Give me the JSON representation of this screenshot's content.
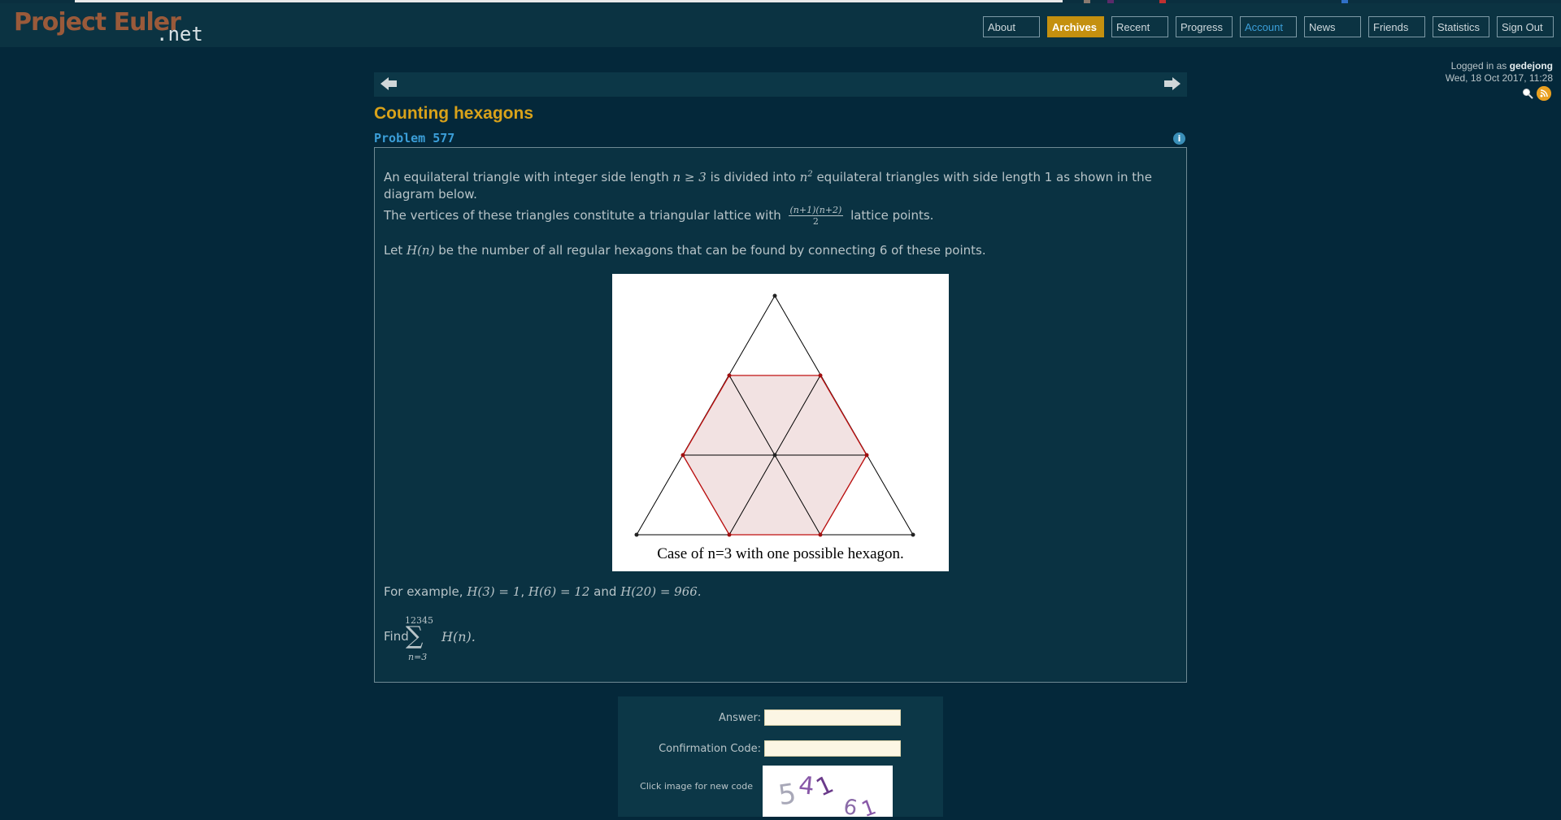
{
  "header": {
    "logo": "Project Euler",
    "logo_suffix": ".net",
    "nav": [
      {
        "label": "About"
      },
      {
        "label": "Archives"
      },
      {
        "label": "Recent"
      },
      {
        "label": "Progress"
      },
      {
        "label": "Account"
      },
      {
        "label": "News"
      },
      {
        "label": "Friends"
      },
      {
        "label": "Statistics"
      },
      {
        "label": "Sign Out"
      }
    ],
    "active_tab": "Archives"
  },
  "user": {
    "prefix": "Logged in as",
    "name": "gedejong",
    "datetime": "Wed, 18 Oct 2017, 11:28"
  },
  "problem": {
    "title": "Counting hexagons",
    "number": "Problem 577",
    "p1a": "An equilateral triangle with integer side length",
    "p1m1": "n ≥ 3",
    "p1b": "is divided into",
    "p1m2": "n",
    "p1m2exp": "2",
    "p1c": "equilateral triangles with side length 1 as shown in the",
    "p1d": "diagram below.",
    "p2a": "The vertices of these triangles constitute a triangular lattice with",
    "frac_num": "(n+1)(n+2)",
    "frac_den": "2",
    "p2b": "lattice points.",
    "p3a": "Let",
    "p3m": "H(n)",
    "p3b": "be the number of all regular hexagons that can be found by connecting 6 of these points.",
    "caption": "Case of n=3 with one possible hexagon.",
    "ex_prefix": "For example,",
    "ex_m1": "H(3) = 1",
    "ex_m2": "H(6) = 12",
    "ex_and": "and",
    "ex_m3": "H(20) = 966.",
    "find": "Find",
    "sum_upper": "12345",
    "sum_lower": "n=3",
    "sum_expr": "H(n)."
  },
  "answer_form": {
    "answer_label": "Answer:",
    "answer_value": "",
    "confirm_label": "Confirmation Code:",
    "confirm_value": "",
    "captcha_hint": "Click image for new code",
    "captcha_text": "54161"
  },
  "colors": {
    "background": "#04283a",
    "accent": "#c4900f",
    "title": "#d9a21a",
    "link": "#3b9ed8"
  }
}
